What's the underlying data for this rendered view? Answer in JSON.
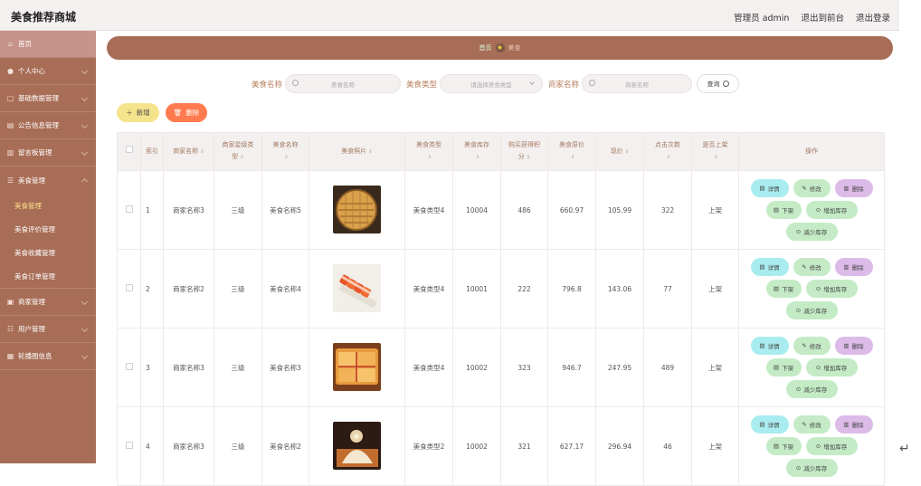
{
  "app": {
    "title": "美食推荐商城"
  },
  "topbar": {
    "admin_label": "管理员 admin",
    "front_label": "退出到前台",
    "logout_label": "退出登录"
  },
  "sidebar": {
    "home": "首页",
    "items": [
      {
        "label": "个人中心"
      },
      {
        "label": "基础数据管理"
      },
      {
        "label": "公告信息管理"
      },
      {
        "label": "留言板管理"
      },
      {
        "label": "美食管理"
      }
    ],
    "sub_items": [
      {
        "label": "美食管理"
      },
      {
        "label": "美食评价管理"
      },
      {
        "label": "美食收藏管理"
      },
      {
        "label": "美食订单管理"
      }
    ],
    "bottom_items": [
      {
        "label": "商家管理"
      },
      {
        "label": "用户管理"
      },
      {
        "label": "轮播图信息"
      }
    ]
  },
  "breadcrumb": {
    "home": "首页",
    "current": "美食"
  },
  "filters": {
    "name_label": "美食名称",
    "name_placeholder": "美食名称",
    "type_label": "美食类型",
    "type_placeholder": "请选择美食类型",
    "shop_label": "商家名称",
    "shop_placeholder": "商家名称",
    "query_label": "查询"
  },
  "actions": {
    "add_label": "新增",
    "delete_label": "删除"
  },
  "table": {
    "headers": {
      "index": "索引",
      "shop": "商家名称",
      "star_line1": "商家星级类",
      "star_line2": "型",
      "name": "美食名称",
      "photo": "美食照片",
      "type": "美食类型",
      "stock": "美食库存",
      "points_line1": "购买获得积",
      "points_line2": "分",
      "orig_price": "美食原价",
      "price": "现价",
      "clicks": "点击次数",
      "onsale": "是否上架",
      "ops": "操作"
    },
    "op_labels": {
      "detail": "详情",
      "edit": "修改",
      "remove": "删除",
      "down": "下架",
      "inc": "增加库存",
      "dec": "减少库存"
    },
    "rows": [
      {
        "index": "1",
        "shop": "商家名称3",
        "star": "三级",
        "name": "美食名称5",
        "photo": "grilled-pancake",
        "type": "美食类型4",
        "stock": "10004",
        "points": "486",
        "orig_price": "660.97",
        "price": "105.99",
        "clicks": "322",
        "onsale": "上架"
      },
      {
        "index": "2",
        "shop": "商家名称2",
        "star": "三级",
        "name": "美食名称4",
        "photo": "sushi-roll",
        "type": "美食类型4",
        "stock": "10001",
        "points": "222",
        "orig_price": "796.8",
        "price": "143.06",
        "clicks": "77",
        "onsale": "上架"
      },
      {
        "index": "3",
        "shop": "商家名称3",
        "star": "三级",
        "name": "美食名称3",
        "photo": "toast-sandwich",
        "type": "美食类型4",
        "stock": "10002",
        "points": "323",
        "orig_price": "946.7",
        "price": "247.95",
        "clicks": "489",
        "onsale": "上架"
      },
      {
        "index": "4",
        "shop": "商家名称3",
        "star": "三级",
        "name": "美食名称2",
        "photo": "cream-roll",
        "type": "美食类型2",
        "stock": "10002",
        "points": "321",
        "orig_price": "627.17",
        "price": "296.94",
        "clicks": "46",
        "onsale": "上架"
      }
    ]
  },
  "colors": {
    "sidebar": "#a86d56",
    "accent_add": "#f6e48d",
    "accent_delete": "#ff7b4f"
  }
}
